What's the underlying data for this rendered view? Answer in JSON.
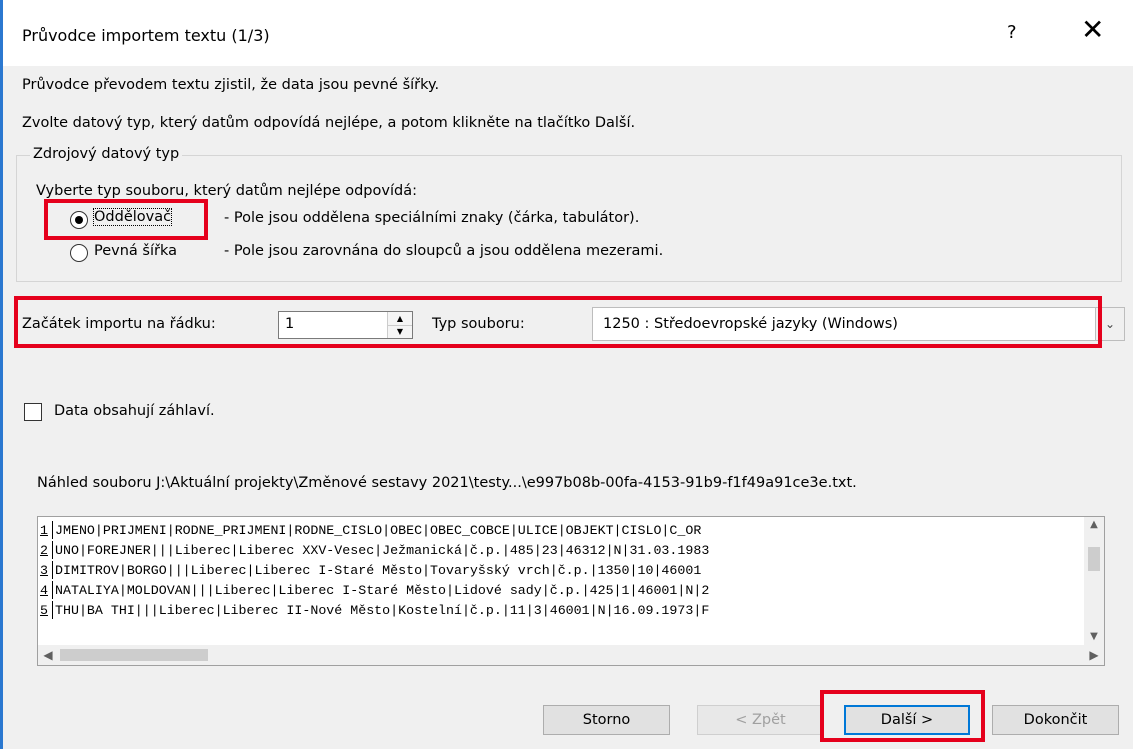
{
  "window": {
    "title": "Průvodce importem textu (1/3)",
    "help_label": "?",
    "close_label": "✕"
  },
  "intro": {
    "line1": "Průvodce převodem textu zjistil, že data jsou pevné šířky.",
    "line2": "Zvolte datový typ, který datům odpovídá nejlépe, a potom klikněte na tlačítko Další."
  },
  "source_group": {
    "title": "Zdrojový datový typ",
    "prompt": "Vyberte typ souboru, který datům nejlépe odpovídá:",
    "options": [
      {
        "label": "Oddělovač",
        "description": "- Pole jsou oddělena speciálními znaky (čárka, tabulátor).",
        "selected": true
      },
      {
        "label": "Pevná šířka",
        "description": "- Pole jsou zarovnána do sloupců a jsou oddělena mezerami.",
        "selected": false
      }
    ]
  },
  "start_row": {
    "label": "Začátek importu na řádku:",
    "value": "1"
  },
  "file_type": {
    "label": "Typ souboru:",
    "value": "1250 : Středoevropské jazyky (Windows)"
  },
  "header_checkbox": {
    "label": "Data obsahují záhlaví.",
    "checked": false
  },
  "preview": {
    "caption": "Náhled souboru J:\\Aktuální projekty\\Změnové sestavy 2021\\testy...\\e997b08b-00fa-4153-91b9-f1f49a91ce3e.txt.",
    "lines": [
      {
        "num": "1",
        "text": "JMENO|PRIJMENI|RODNE_PRIJMENI|RODNE_CISLO|OBEC|OBEC_COBCE|ULICE|OBJEKT|CISLO|C_OR"
      },
      {
        "num": "2",
        "text": "UNO|FOREJNER|||Liberec|Liberec XXV-Vesec|Ježmanická|č.p.|485|23|46312|N|31.03.1983"
      },
      {
        "num": "3",
        "text": "DIMITROV|BORGO|||Liberec|Liberec I-Staré Město|Tovaryšský vrch|č.p.|1350|10|46001"
      },
      {
        "num": "4",
        "text": "NATALIYA|MOLDOVAN|||Liberec|Liberec I-Staré Město|Lidové sady|č.p.|425|1|46001|N|2"
      },
      {
        "num": "5",
        "text": "THU|BA THI|||Liberec|Liberec II-Nové Město|Kostelní|č.p.|11|3|46001|N|16.09.1973|F"
      }
    ]
  },
  "buttons": {
    "cancel": "Storno",
    "back": "< Zpět",
    "next": "Další >",
    "finish": "Dokončit"
  },
  "colors": {
    "highlight_red": "#e5001c",
    "default_button_blue": "#0078d7"
  },
  "icons": {
    "scroll_up": "▲",
    "scroll_down": "▼",
    "scroll_left": "◀",
    "scroll_right": "▶",
    "combo_arrow": "⌄"
  }
}
